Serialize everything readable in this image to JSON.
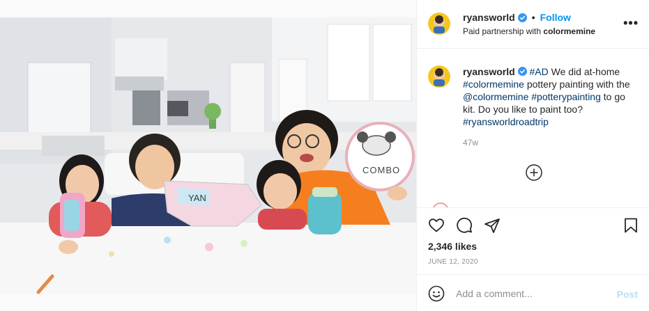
{
  "post": {
    "username": "ryansworld",
    "follow_label": "Follow",
    "separator": "•",
    "partnership_prefix": "Paid partnership with",
    "partner": "colormemine",
    "more_label": "•••"
  },
  "caption": {
    "username": "ryansworld",
    "segments": [
      {
        "type": "tag",
        "text": "#AD"
      },
      {
        "type": "text",
        "text": " We did at-home "
      },
      {
        "type": "tag",
        "text": "#colormemine"
      },
      {
        "type": "text",
        "text": " pottery painting with the "
      },
      {
        "type": "tag",
        "text": "@colormemine"
      },
      {
        "type": "text",
        "text": " "
      },
      {
        "type": "tag",
        "text": "#potterypainting"
      },
      {
        "type": "text",
        "text": " to go kit. Do you like to paint too? "
      },
      {
        "type": "tag",
        "text": "#ryansworldroadtrip"
      }
    ],
    "time_ago": "47w"
  },
  "photo": {
    "plate_text": "COMBO",
    "map_text": "YAN"
  },
  "actions": {
    "icons": [
      "heart-icon",
      "comment-icon",
      "share-icon",
      "bookmark-icon"
    ],
    "likes": "2,346 likes",
    "date": "JUNE 12, 2020"
  },
  "comment_bar": {
    "placeholder": "Add a comment...",
    "post_label": "Post"
  },
  "colors": {
    "accent": "#0095f6",
    "tag": "#00376b",
    "muted": "#8e8e8e",
    "post_disabled": "#b2dffc",
    "verified": "#3897f0"
  }
}
